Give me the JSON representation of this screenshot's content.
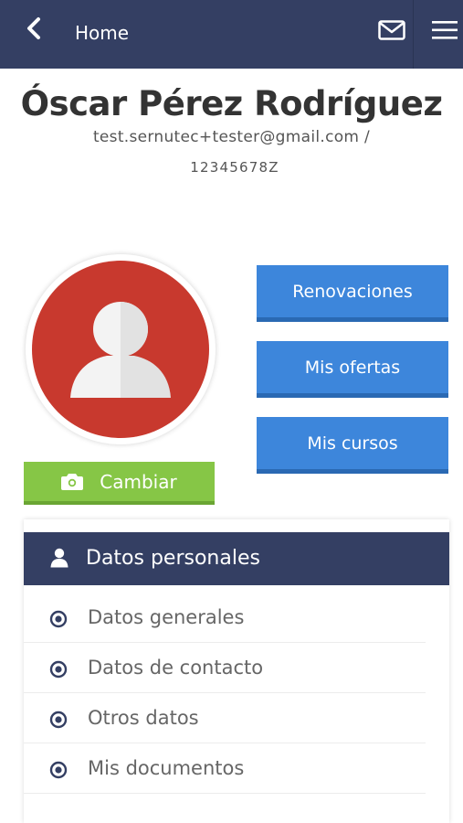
{
  "header": {
    "title": "Home",
    "back_icon": "chevron-left-icon",
    "mail_icon": "mail-icon",
    "menu_icon": "hamburger-menu-icon",
    "background": "#343f63"
  },
  "profile": {
    "name": "Óscar Pérez Rodríguez",
    "email_line": "test.sernutec+tester@gmail.com /",
    "id_number": "12345678Z",
    "avatar_icon": "user-silhouette-icon",
    "avatar_color": "#c8392e",
    "change_button": {
      "label": "Cambiar",
      "icon": "camera-icon",
      "color": "#86c646"
    }
  },
  "actions": {
    "color": "#3d86db",
    "items": [
      {
        "label": "Renovaciones"
      },
      {
        "label": "Mis ofertas"
      },
      {
        "label": "Mis cursos"
      }
    ]
  },
  "personal_panel": {
    "title": "Datos personales",
    "title_icon": "user-icon",
    "item_icon": "radio-dot-icon",
    "items": [
      {
        "label": "Datos generales"
      },
      {
        "label": "Datos de contacto"
      },
      {
        "label": "Otros datos"
      },
      {
        "label": "Mis documentos"
      }
    ]
  }
}
